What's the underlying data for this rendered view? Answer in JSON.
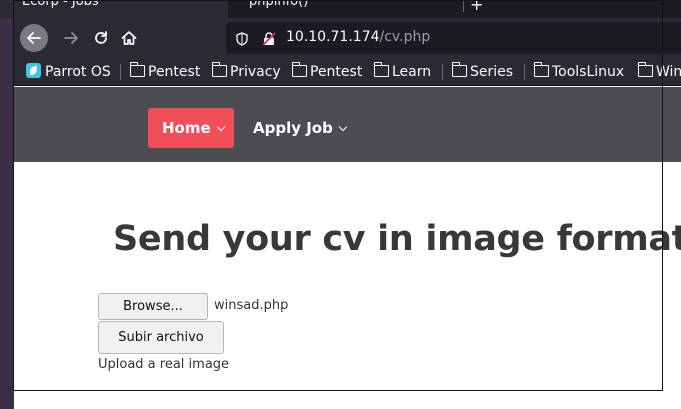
{
  "browser": {
    "tabs": [
      {
        "title": "Ecorp - Jobs",
        "active": true
      },
      {
        "title": "phpinfo()",
        "active": false
      }
    ],
    "url": {
      "host": "10.10.71.174",
      "path": "/cv.php"
    },
    "bookmarks": [
      {
        "label": "Parrot OS",
        "icon": "parrot-icon"
      },
      {
        "label": "Pentest",
        "icon": "folder-icon"
      },
      {
        "label": "Privacy",
        "icon": "folder-icon"
      },
      {
        "label": "Pentest",
        "icon": "folder-icon"
      },
      {
        "label": "Learn",
        "icon": "folder-icon"
      },
      {
        "label": "Series",
        "icon": "folder-icon"
      },
      {
        "label": "ToolsLinux",
        "icon": "folder-icon"
      },
      {
        "label": "Win",
        "icon": "folder-icon"
      }
    ]
  },
  "site": {
    "nav": {
      "home": "Home",
      "apply": "Apply Job"
    },
    "title": "Send your cv in image format",
    "form": {
      "browse_label": "Browse...",
      "file_name": "winsad.php",
      "submit_label": "Subir archivo",
      "hint": "Upload a real image"
    }
  },
  "colors": {
    "accent": "#f04e58",
    "nav_bg": "#4b4d52",
    "browser_bg": "#2b2a33"
  }
}
